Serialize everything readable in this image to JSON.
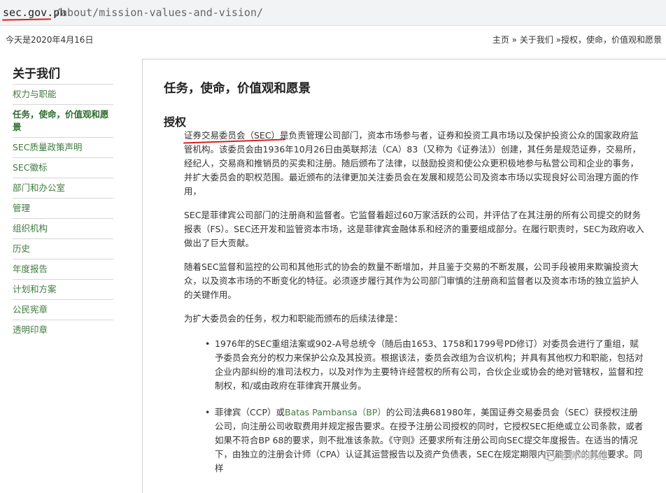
{
  "browser": {
    "url_domain": "sec.gov.ph",
    "url_path": "/about/mission-values-and-vision/"
  },
  "header": {
    "date": "今天是2020年4月16日",
    "breadcrumb": {
      "home": "主页",
      "sep1": " » ",
      "about": "关于我们",
      "sep2": " »",
      "current": "授权，使命，价值观和愿景"
    }
  },
  "sidebar": {
    "title": "关于我们",
    "items": [
      {
        "label": "权力与职能"
      },
      {
        "label": "任务，使命，价值观和愿景"
      },
      {
        "label": "SEC质量政策声明"
      },
      {
        "label": "SEC徽标"
      },
      {
        "label": "部门和办公室"
      },
      {
        "label": "管理"
      },
      {
        "label": "组织机构"
      },
      {
        "label": "历史"
      },
      {
        "label": "年度报告"
      },
      {
        "label": "计划和方案"
      },
      {
        "label": "公民宪章"
      },
      {
        "label": "透明印章"
      }
    ]
  },
  "main": {
    "title": "任务，使命，价值观和愿景",
    "section_heading": "授权",
    "paragraphs": [
      "证券交易委员会（SEC）是负责管理公司部门，资本市场参与者，证券和投资工具市场以及保护投资公众的国家政府监管机构。该委员会由1936年10月26日由英联邦法（CA）83（又称为《证券法》）创建，其任务是规范证券，交易所，经纪人，交易商和推销员的买卖和注册。随后颁布了法律，以鼓励投资和使公众更积极地参与私营公司和企业的事务，并扩大委员会的职权范围。最近颁布的法律更加关注委员会在发展和规范公司及资本市场以实现良好公司治理方面的作用，",
      "SEC是菲律宾公司部门的注册商和监督者。它监督着超过60万家活跃的公司，并评估了在其注册的所有公司提交的财务报表（FS）。SEC还开发和监管资本市场，这是菲律宾金融体系和经济的重要组成部分。在履行职责时，SEC为政府收入做出了巨大贡献。",
      "随着SEC监督和监控的公司和其他形式的协会的数量不断增加，并且鉴于交易的不断发展，公司手段被用来欺骗投资大众，以及资本市场的不断变化的特征。必须逐步履行其作为公司部门审慎的注册商和监督者以及资本市场的独立监护人的关键作用。",
      "为扩大委员会的任务，权力和职能而颁布的后续法律是："
    ],
    "laws": [
      {
        "bullet": "•",
        "text": "1976年的SEC重组法案或902-A号总统令（随后由1653、1758和1799号PD修订）对委员会进行了重组，赋予委员会充分的权力来保护公众及其投资。根据该法，委员会改组为合议机构；并具有其他权力和职能，包括对企业内部纠纷的准司法权力，以及对作为主要特许经营权的所有公司，合伙企业或协会的绝对管辖权，监督和控制权，和/或由政府在菲律宾开展业务。"
      },
      {
        "bullet": "•",
        "prefix": "菲律宾（CCP）或",
        "link": "Batas Pambansa（BP）",
        "text": "的公司法典681980年，美国证券交易委员会（SEC）获授权注册公司，向注册公司收取费用并规定报告要求。在授予注册公司授权的同时，它授权SEC拒绝或立公司条款，或者如果不符合BP 68的要求，则不批准该条款。《守则》还要求所有注册公司向SEC提交年度报告。在适当的情况下，由独立的注册会计师（CPA）认证其运营报告以及资产负债表，SEC在规定期限内可能要求的其他要求。同样"
      }
    ]
  },
  "watermark": {
    "text": "老狮鸣财经"
  },
  "colors": {
    "link_green": "#3f7a3f",
    "annotation_red": "#d9201f"
  }
}
